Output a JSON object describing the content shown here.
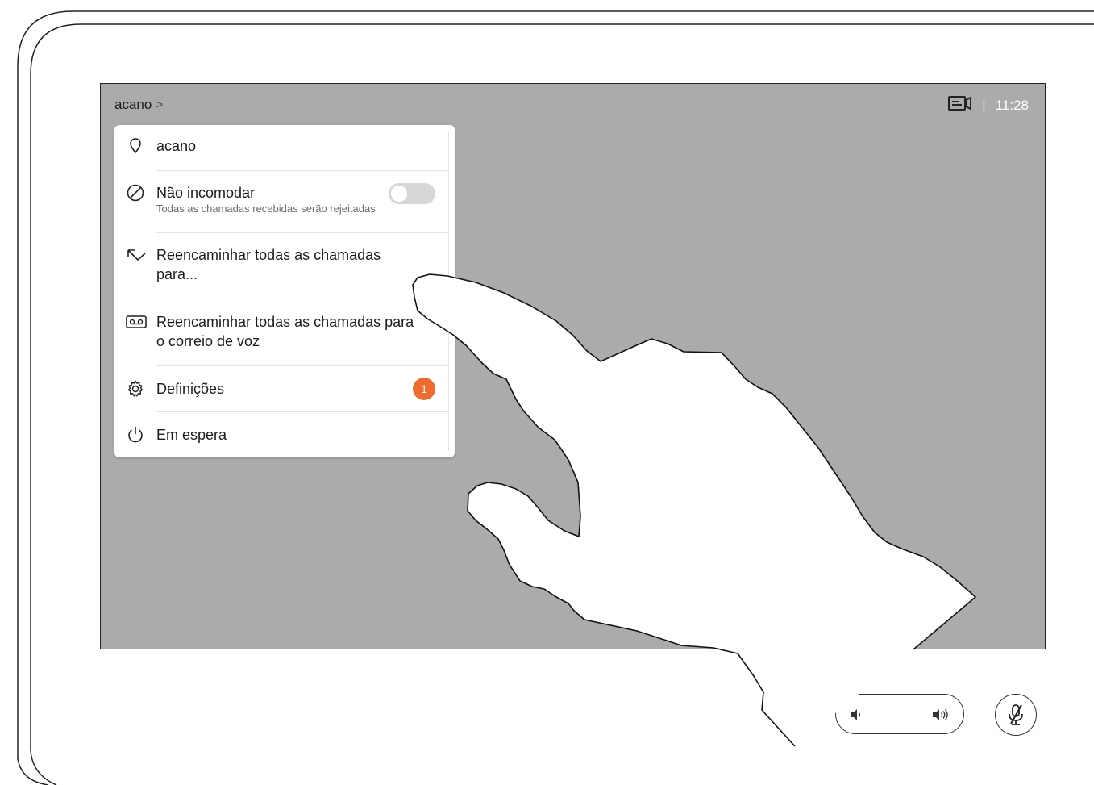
{
  "topbar": {
    "title": "acano",
    "chevron": ">",
    "separator": "|",
    "time": "11:28",
    "layout_icon": "screen-layout-icon"
  },
  "menu": {
    "items": [
      {
        "label": "acano",
        "icon": "location-pin-icon"
      },
      {
        "label": "Não incomodar",
        "sublabel": "Todas as chamadas recebidas serão rejeitadas",
        "icon": "do-not-disturb-icon",
        "toggle_on": false
      },
      {
        "label_line1": "Reencaminhar todas as chamadas",
        "label_line2": "para...",
        "icon": "call-forward-icon"
      },
      {
        "label_line1": "Reencaminhar todas as chamadas para",
        "label_line2": "o correio de voz",
        "icon": "voicemail-icon"
      },
      {
        "label": "Definições",
        "icon": "gear-icon",
        "badge": "1"
      },
      {
        "label": "Em espera",
        "icon": "power-icon"
      }
    ]
  },
  "controls": {
    "volume_down_icon": "volume-down-icon",
    "volume_up_icon": "volume-up-icon",
    "mute_icon": "microphone-muted-icon"
  },
  "colors": {
    "screen_bg": "#ababab",
    "badge": "#f26b2e",
    "menu_bg": "#ffffff"
  }
}
